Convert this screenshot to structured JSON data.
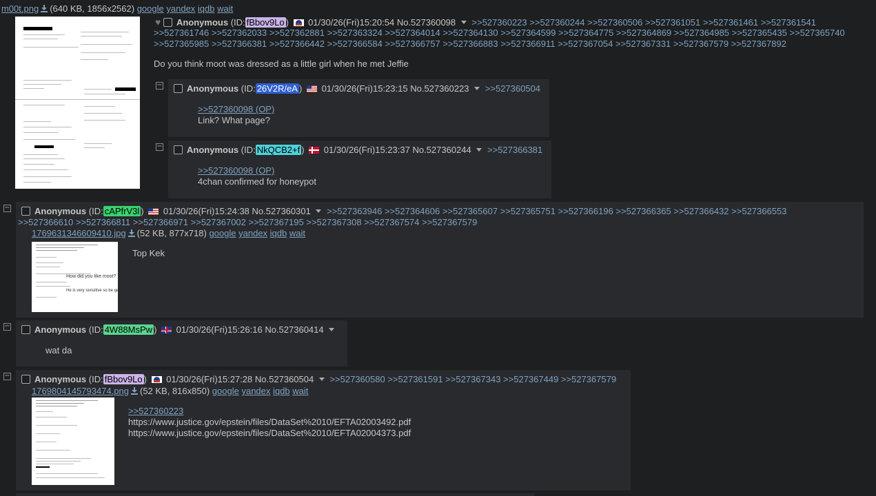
{
  "op": {
    "file_name": "m00t.png",
    "file_info": "(640 KB, 1856x2562)",
    "links": [
      "google",
      "yandex",
      "iqdb",
      "wait"
    ],
    "name": "Anonymous",
    "id_prefix": "(ID:",
    "id": "fBbov9Lo",
    "id_suffix": ")",
    "id_color": "#c9b3e8",
    "datetime": "01/30/26(Fri)15:20:54",
    "no": "No.527360098",
    "backlinks_1": ">>527360223 >>527360244 >>527360506 >>527361051 >>527361461 >>527361541",
    "backlinks_2": ">>527361746 >>527362033 >>527362881 >>527363324 >>527364014 >>527364130 >>527364599 >>527364775 >>527364869 >>527364985 >>527365435 >>527365740",
    "backlinks_3": ">>527365985 >>527366381 >>527366442 >>527366584 >>527366757 >>527366883 >>527366911 >>527367054 >>527367331 >>527367579 >>527367892",
    "message": "Do you think moot was dressed as a little girl when he met Jeffie"
  },
  "replies": [
    {
      "name": "Anonymous",
      "id": "26V2R/eA",
      "id_color": "#2f5fd1",
      "datetime": "01/30/26(Fri)15:23:15",
      "no": "No.527360223",
      "backlinks": ">>527360504",
      "quote": ">>527360098 (OP)",
      "message": "Link? What page?"
    },
    {
      "name": "Anonymous",
      "id": "NkQCB2+f",
      "id_color": "#4fd1d9",
      "datetime": "01/30/26(Fri)15:23:37",
      "no": "No.527360244",
      "backlinks": ">>527366381",
      "quote": ">>527360098 (OP)",
      "message": "4chan confirmed for honeypot"
    },
    {
      "name": "Anonymous",
      "id": "cAPfrV3l",
      "id_color": "#37d46e",
      "datetime": "01/30/26(Fri)15:24:38",
      "no": "No.527360301",
      "backlinks_1": ">>527363946 >>527364606 >>527365607 >>527365751 >>527366196 >>527366365 >>527366432 >>527366553",
      "backlinks_2": ">>527366610 >>527366811 >>527366971 >>527367002 >>527367195 >>527367308 >>527367574 >>527367579",
      "file_name": "1769631346609410.jpg",
      "file_info": "(52 KB, 877x718)",
      "message": "Top Kek",
      "thumb_text_1": "How did you like moot?",
      "thumb_text_2": "He is very sensitive so be gentle"
    },
    {
      "name": "Anonymous",
      "id": "4W88MsPw",
      "id_color": "#58d68d",
      "datetime": "01/30/26(Fri)15:26:16",
      "no": "No.527360414",
      "message": "wat da"
    },
    {
      "name": "Anonymous",
      "id": "fBbov9Lo",
      "id_color": "#c9b3e8",
      "datetime": "01/30/26(Fri)15:27:28",
      "no": "No.527360504",
      "backlinks": ">>527360580 >>527361591 >>527367343 >>527367449 >>527367579",
      "file_name": "1769804145793474.png",
      "file_info": "(52 KB, 816x850)",
      "quote": ">>527360223",
      "message_1": "https://www.justice.gov/epstein/files/DataSet%2010/EFTA02003492.pdf",
      "message_2": "https://www.justice.gov/epstein/files/DataSet%2010/EFTA02004373.pdf"
    }
  ],
  "icons": {
    "minus": "−"
  }
}
